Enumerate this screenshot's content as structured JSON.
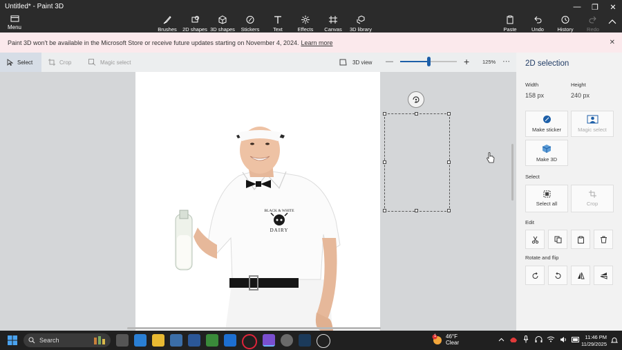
{
  "window": {
    "title": "Untitled* - Paint 3D"
  },
  "topbar": {
    "menu_label": "Menu",
    "tools": [
      {
        "label": "Brushes",
        "icon": "brush-icon"
      },
      {
        "label": "2D shapes",
        "icon": "2d-shapes-icon"
      },
      {
        "label": "3D shapes",
        "icon": "3d-shapes-icon"
      },
      {
        "label": "Stickers",
        "icon": "stickers-icon"
      },
      {
        "label": "Text",
        "icon": "text-icon"
      },
      {
        "label": "Effects",
        "icon": "effects-icon"
      },
      {
        "label": "Canvas",
        "icon": "canvas-icon"
      },
      {
        "label": "3D library",
        "icon": "3d-library-icon"
      }
    ],
    "right_tools": [
      {
        "label": "Paste",
        "icon": "paste-icon"
      },
      {
        "label": "Undo",
        "icon": "undo-icon"
      },
      {
        "label": "History",
        "icon": "history-icon"
      },
      {
        "label": "Redo",
        "icon": "redo-icon"
      }
    ]
  },
  "banner": {
    "text": "Paint 3D won't be available in the Microsoft Store or receive future updates starting on November 4, 2024.",
    "link": "Learn more"
  },
  "subbar": {
    "select": "Select",
    "crop": "Crop",
    "magic_select": "Magic select",
    "view3d": "3D view",
    "zoom_value": "125%",
    "zoom_level": 0.5
  },
  "panel": {
    "title": "2D selection",
    "width_label": "Width",
    "width_value": "158 px",
    "height_label": "Height",
    "height_value": "240 px",
    "make_sticker": "Make sticker",
    "magic_select": "Magic select",
    "make_3d": "Make 3D",
    "select_section": "Select",
    "select_all": "Select all",
    "crop": "Crop",
    "edit_section": "Edit",
    "rotate_section": "Rotate and flip"
  },
  "canvas_image": {
    "logo_line1": "BLACK & WHITE",
    "logo_line2": "DAIRY"
  },
  "taskbar": {
    "search": "Search",
    "weather_temp": "46°F",
    "weather_cond": "Clear",
    "weather_badge": "1",
    "time": "11:46 PM",
    "date": "11/29/2025"
  },
  "colors": {
    "accent": "#1d5fa8",
    "banner_bg": "#fbe9ec",
    "topbar_bg": "#2b2b2b"
  }
}
